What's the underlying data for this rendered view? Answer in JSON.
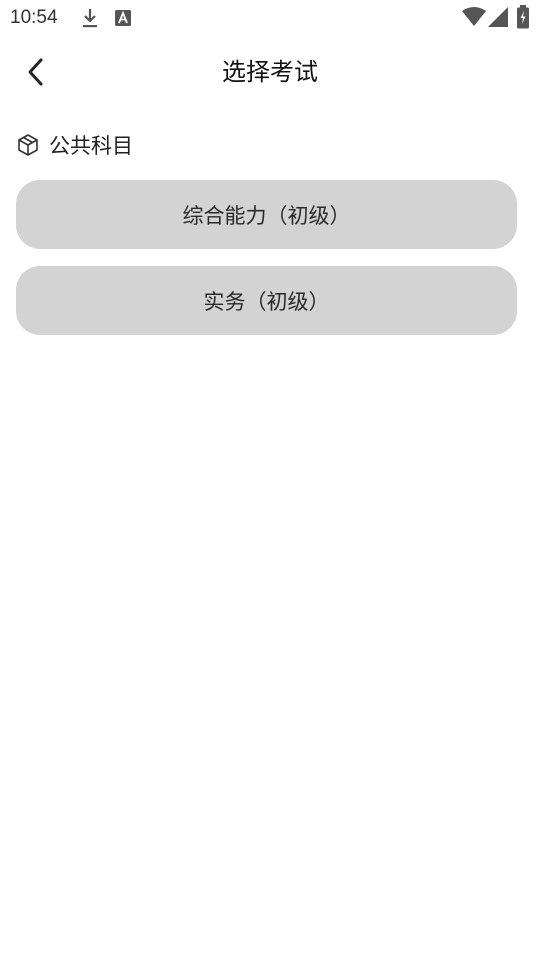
{
  "status_bar": {
    "time": "10:54",
    "icons": [
      "download-icon",
      "text-a-icon",
      "wifi-icon",
      "cell-signal-icon",
      "battery-charging-icon"
    ]
  },
  "header": {
    "title": "选择考试",
    "back_icon": "chevron-left-icon"
  },
  "section": {
    "icon": "cube-icon",
    "label": "公共科目"
  },
  "exams": [
    {
      "label": "综合能力（初级）"
    },
    {
      "label": "实务（初级）"
    }
  ],
  "colors": {
    "background": "#ffffff",
    "option_bg": "#d3d3d3",
    "text": "#222222"
  }
}
